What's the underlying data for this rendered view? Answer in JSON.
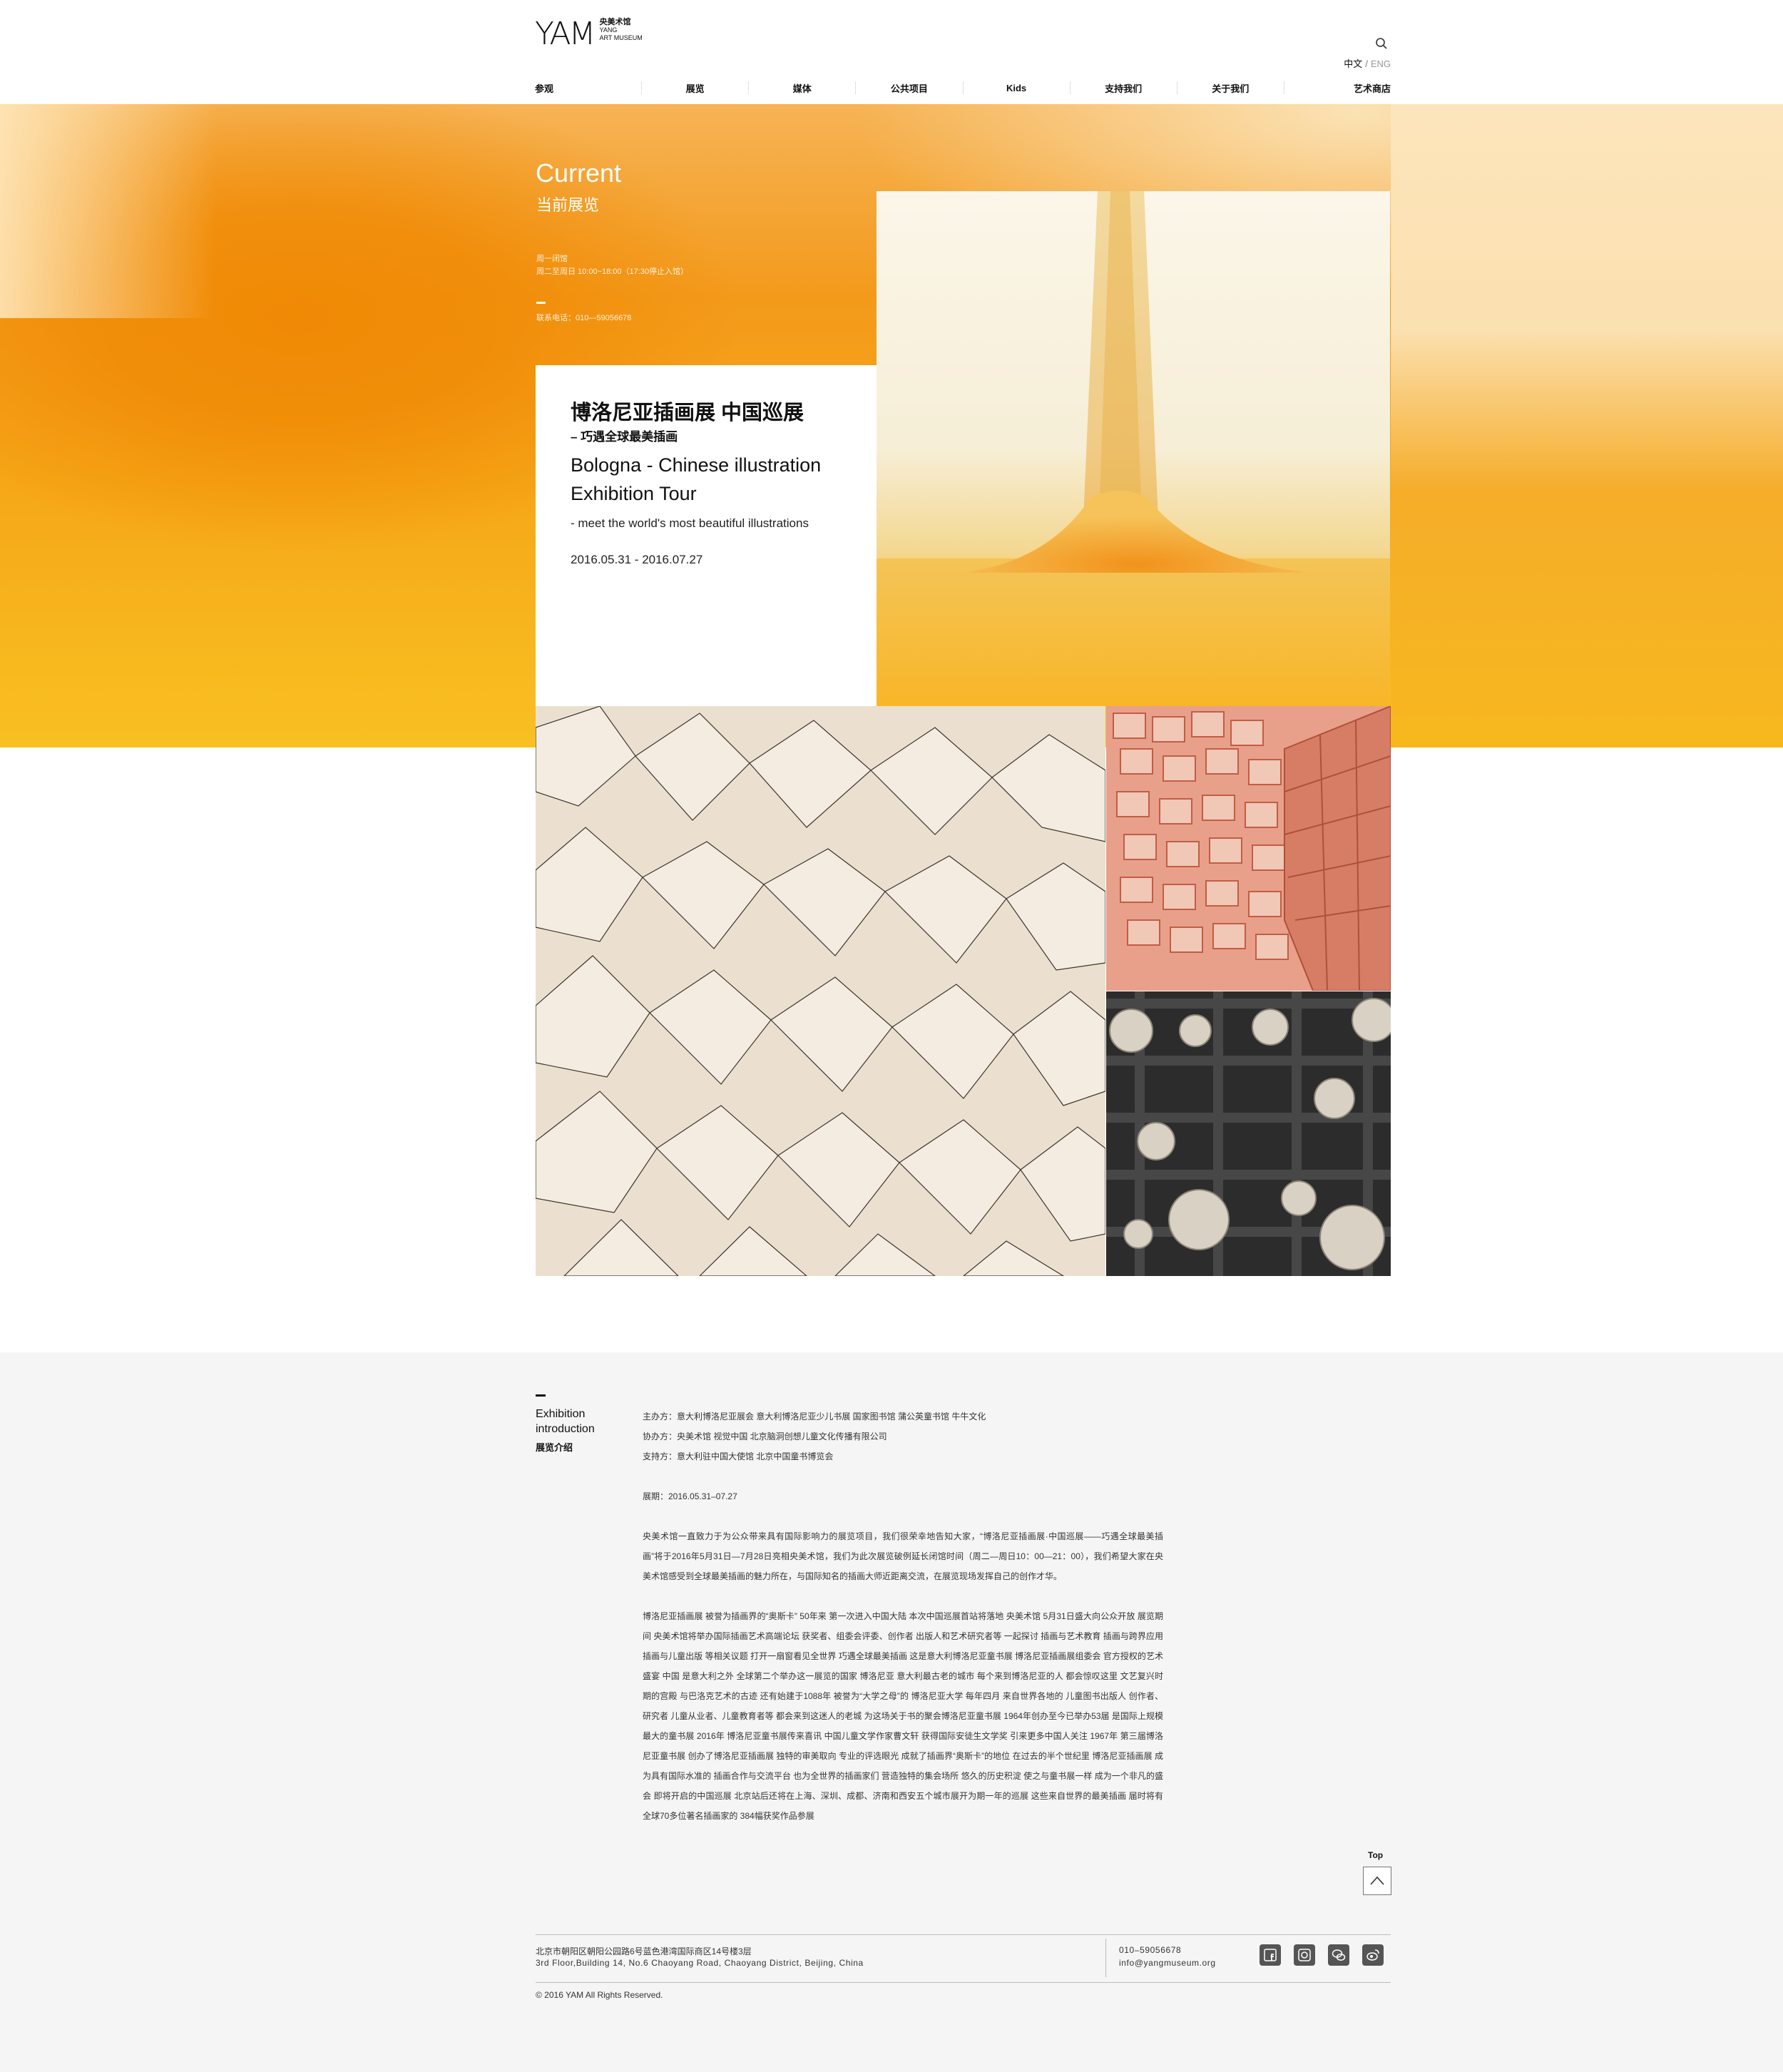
{
  "header": {
    "logo_mark": "YAM",
    "logo_cn": "央美术馆",
    "logo_en_1": "YANG",
    "logo_en_2": "ART MUSEUM",
    "lang_cn": "中文",
    "lang_sep": "/",
    "lang_en": "ENG",
    "search_icon": "search-icon"
  },
  "nav": [
    "参观",
    "展览",
    "媒体",
    "公共项目",
    "Kids",
    "支持我们",
    "关于我们",
    "艺术商店"
  ],
  "hero": {
    "title_en": "Current",
    "title_cn": "当前展览",
    "hours_1": "周一闭馆",
    "hours_2": "周二至周日 10:00~18:00（17:30停止入馆）",
    "phone": "联系电话：010—59056678"
  },
  "exhibition": {
    "title_cn": "博洛尼亚插画展 中国巡展",
    "subtitle_cn": "– 巧遇全球最美插画",
    "title_en_1": "Bologna - Chinese illustration",
    "title_en_2": "Exhibition Tour",
    "subtitle_en": "- meet the world's most beautiful illustrations",
    "dates": "2016.05.31 - 2016.07.27"
  },
  "intro": {
    "label_en_1": "Exhibition",
    "label_en_2": "introduction",
    "label_cn": "展览介绍",
    "organizer": "主办方：意大利博洛尼亚展会 意大利博洛尼亚少儿书展 国家图书馆 蒲公英童书馆 牛牛文化",
    "co_organizer": "协办方：央美术馆 视觉中国 北京脑洞创想儿童文化传播有限公司",
    "supporter": "支持方：意大利驻中国大使馆 北京中国童书博览会",
    "period": "展期：2016.05.31–07.27",
    "para1": "央美术馆一直致力于为公众带来具有国际影响力的展览项目，我们很荣幸地告知大家，“博洛尼亚插画展·中国巡展——巧遇全球最美插画”将于2016年5月31日—7月28日亮相央美术馆，我们为此次展览破例延长闭馆时间（周二—周日10：00—21：00），我们希望大家在央美术馆感受到全球最美插画的魅力所在，与国际知名的插画大师近距离交流，在展览现场发挥自己的创作才华。",
    "para2": "博洛尼亚插画展 被誉为插画界的“奥斯卡” 50年来 第一次进入中国大陆 本次中国巡展首站将落地 央美术馆 5月31日盛大向公众开放 展览期间 央美术馆将举办国际插画艺术高端论坛 获奖者、组委会评委、创作者 出版人和艺术研究者等 一起探讨 插画与艺术教育 插画与跨界应用 插画与儿童出版 等相关议题 打开一扇窗看见全世界 巧遇全球最美插画 这是意大利博洛尼亚童书展 博洛尼亚插画展组委会 官方授权的艺术盛宴 中国 是意大利之外 全球第二个举办这一展览的国家 博洛尼亚 意大利最古老的城市 每个来到博洛尼亚的人 都会惊叹这里 文艺复兴时期的宫殿 与巴洛克艺术的古迹 还有始建于1088年 被誉为“大学之母”的 博洛尼亚大学 每年四月 来自世界各地的 儿童图书出版人 创作者、研究者 儿童从业者、儿童教育者等 都会来到这迷人的老城 为这场关于书的聚会博洛尼亚童书展 1964年创办至今已举办53届 是国际上规模最大的童书展 2016年 博洛尼亚童书展传来喜讯 中国儿童文学作家曹文轩 获得国际安徒生文学奖 引来更多中国人关注 1967年 第三届博洛尼亚童书展 创办了博洛尼亚插画展 独特的审美取向 专业的评选眼光 成就了插画界“奥斯卡”的地位 在过去的半个世纪里 博洛尼亚插画展 成为具有国际水准的 插画合作与交流平台 也为全世界的插画家们 营造独特的集会场所 悠久的历史积淀 使之与童书展一样 成为一个非凡的盛会 即将开启的中国巡展 北京站后还将在上海、深圳、成都、济南和西安五个城市展开为期一年的巡展 这些来自世界的最美插画 届时将有全球70多位著名插画家的 384幅获奖作品参展"
  },
  "top_button": {
    "label": "Top"
  },
  "footer": {
    "address_cn": "北京市朝阳区朝阳公园路6号蓝色港湾国际商区14号楼3层",
    "address_en": "3rd Floor,Building 14, No.6 Chaoyang Road, Chaoyang District, Beijing, China",
    "tel": "010–59056678",
    "email": "info@yangmuseum.org",
    "social": [
      "facebook-icon",
      "instagram-icon",
      "wechat-icon",
      "weibo-icon"
    ],
    "copyright": "© 2016 YAM All Rights Reserved."
  },
  "colors": {
    "accent_orange": "#f39a1b",
    "hero_yellow": "#f8c022",
    "intro_bg": "#f5f5f5"
  }
}
